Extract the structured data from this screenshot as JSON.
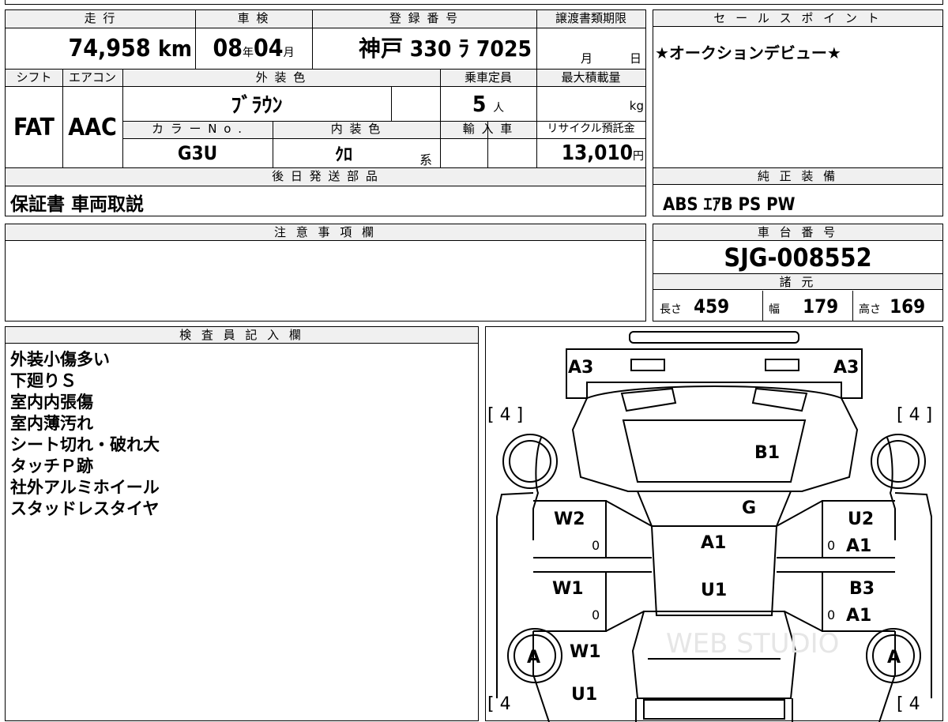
{
  "main": {
    "labels": {
      "mileage": "走 行",
      "inspection": "車 検",
      "registration": "登 録 番 号",
      "transfer_deadline": "譲渡書類期限",
      "shift": "シフト",
      "aircon": "エアコン",
      "exterior_color": "外 装 色",
      "capacity": "乗車定員",
      "max_load": "最大積載量",
      "color_no": "カ ラ ー N o .",
      "interior_color": "内 装 色",
      "import": "輸 入 車",
      "recycle": "リサイクル預託金",
      "later_parts": "後 日 発 送 部 品",
      "caution": "注 意 事 項 欄",
      "inspector": "検 査 員 記 入 欄"
    },
    "mileage_value": "74,958",
    "mileage_unit": "km",
    "inspection_year": "08",
    "inspection_year_unit": "年",
    "inspection_month": "04",
    "inspection_month_unit": "月",
    "registration_value": "神戸 330 ﾗ 7025",
    "deadline_month_unit": "月",
    "deadline_day_unit": "日",
    "shift_value": "FAT",
    "aircon_value": "AAC",
    "exterior_color_value": "ﾌﾞﾗｳﾝ",
    "capacity_value": "5",
    "capacity_unit": "人",
    "max_load_unit": "kg",
    "color_no_value": "G3U",
    "interior_color_value": "ｸﾛ",
    "interior_color_suffix": "系",
    "recycle_value": "13,010",
    "recycle_unit": "円",
    "later_parts_value": "保証書 車両取説",
    "inspector_notes": [
      "外装小傷多い",
      "下廻りＳ",
      "室内内張傷",
      "室内薄汚れ",
      "シート切れ・破れ大",
      "タッチＰ跡",
      "社外アルミホイール",
      "スタッドレスタイヤ"
    ]
  },
  "right": {
    "sales_point_label": "セ ー ル ス ポ イ ン ト",
    "sales_point_value": "★オークションデビュー★",
    "equipment_label": "純 正 装 備",
    "equipment_value": "ABS ｴｱB PS PW",
    "chassis_label": "車 台 番 号",
    "chassis_value": "SJG-008552",
    "dimensions_label": "諸 元",
    "length_label": "長さ",
    "length_value": "459",
    "width_label": "幅",
    "width_value": "179",
    "height_label": "高さ",
    "height_value": "169"
  },
  "diagram": {
    "marks": {
      "a3_left": "A3",
      "a3_right": "A3",
      "tire_fl": "[ 4 ]",
      "tire_fr": "[ 4 ]",
      "tire_rl": "[ 4",
      "tire_rr": "[ 4",
      "b1": "B1",
      "g": "G",
      "w2": "W2",
      "u2": "U2",
      "a1_center": "A1",
      "a1_right_front": "A1",
      "w1_left": "W1",
      "u1_center": "U1",
      "b3": "B3",
      "a1_right_rear": "A1",
      "w1_rear": "W1",
      "u1_rear": "U1",
      "wheel_rl": "A",
      "wheel_rr": "A",
      "zero_1": "0",
      "zero_2": "0",
      "zero_3": "0",
      "zero_4": "0"
    },
    "watermark": "WEB STUDIO"
  }
}
